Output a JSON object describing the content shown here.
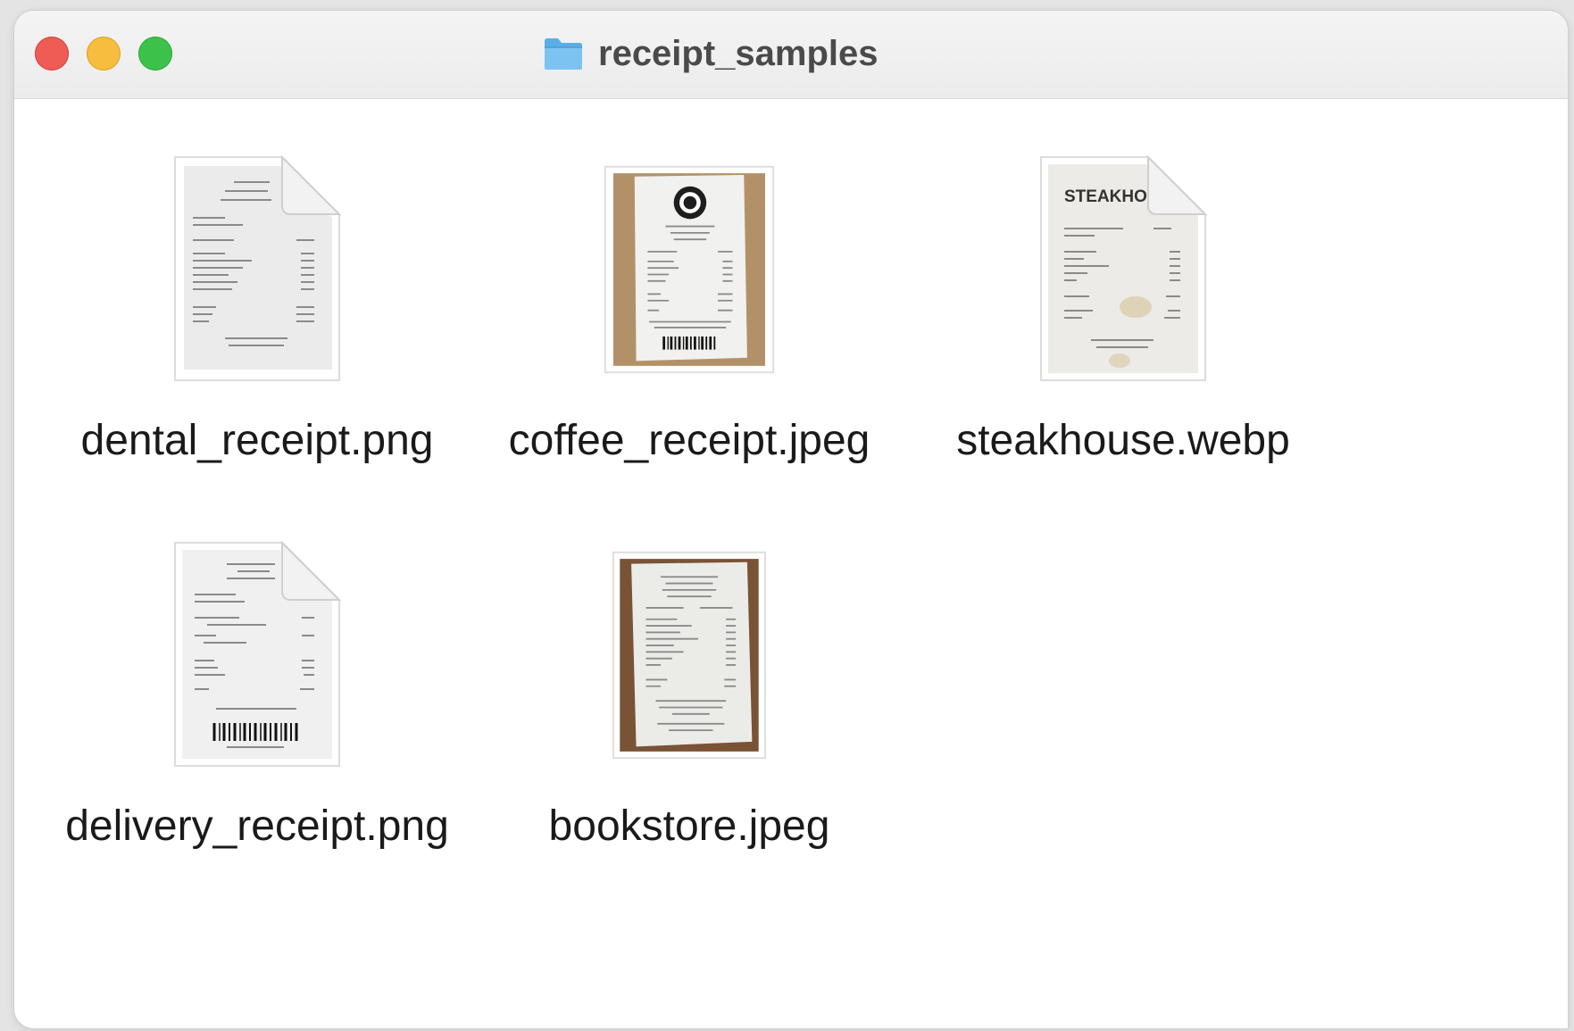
{
  "window": {
    "title": "receipt_samples",
    "traffic_lights": [
      {
        "name": "close",
        "color": "#ee5c55"
      },
      {
        "name": "minimize",
        "color": "#f6bd3f"
      },
      {
        "name": "zoom",
        "color": "#3cc24a"
      }
    ]
  },
  "folder_icon": "folder-icon",
  "files": [
    {
      "name": "dental_receipt.png",
      "thumb": "document-page-curl"
    },
    {
      "name": "coffee_receipt.jpeg",
      "thumb": "photo-on-cardboard",
      "logo_color": "#1e1e1e"
    },
    {
      "name": "steakhouse.webp",
      "thumb": "document-page-curl",
      "header_text": "STEAKHO"
    },
    {
      "name": "delivery_receipt.png",
      "thumb": "document-page-curl"
    },
    {
      "name": "bookstore.jpeg",
      "thumb": "photo-on-wood"
    }
  ]
}
